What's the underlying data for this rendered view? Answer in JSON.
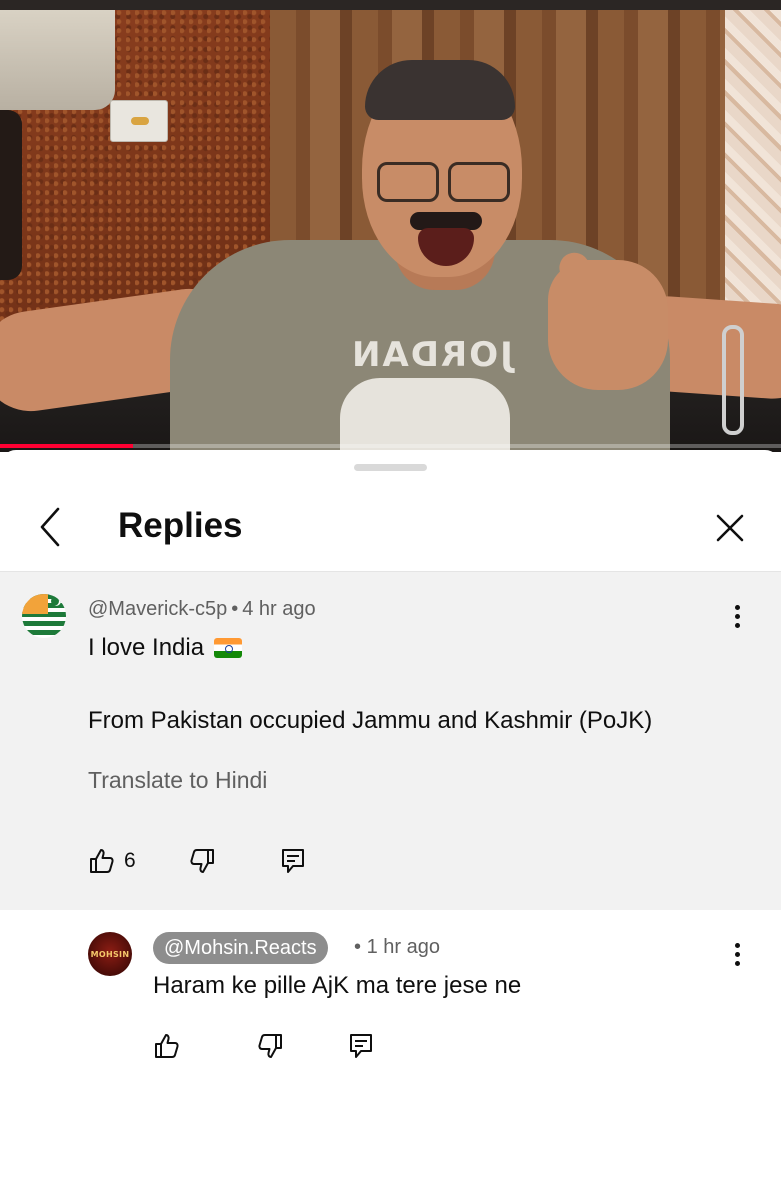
{
  "video": {
    "shirt_text": "JORDAN",
    "progress_fraction": 0.17,
    "progress_color": "#ff0033"
  },
  "sheet": {
    "title": "Replies",
    "back_icon": "chevron-left-icon",
    "close_icon": "close-icon"
  },
  "main_comment": {
    "author": "@Maverick-c5p",
    "separator": "•",
    "time": "4 hr ago",
    "text_line1": "I love India",
    "flag_emoji": "india-flag-emoji",
    "text_line2": "From Pakistan occupied Jammu and Kashmir (PoJK)",
    "translate_label": "Translate to Hindi",
    "like_count": "6",
    "avatar": "kashmir-flag-avatar"
  },
  "reply": {
    "author": "@Mohsin.Reacts",
    "separator": "•",
    "time": "1 hr ago",
    "text": "Haram ke pille AjK ma tere jese ne",
    "avatar_text": "MOHSIN"
  },
  "colors": {
    "accent_red": "#ff0033",
    "comment_bg": "#f2f2f2",
    "secondary_text": "#606060",
    "handle_badge_bg": "#8d8d8d"
  }
}
